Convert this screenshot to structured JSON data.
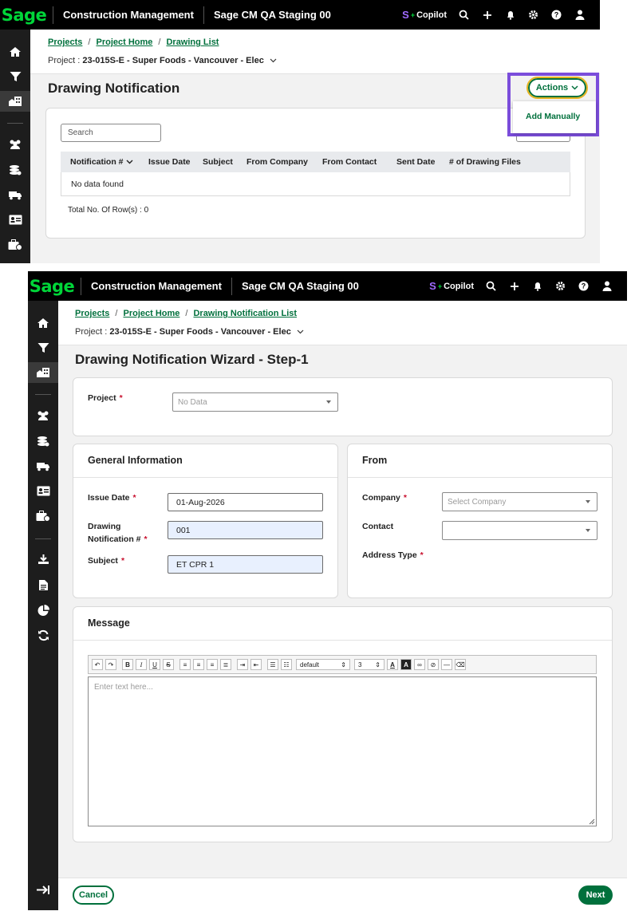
{
  "brand": {
    "logo": "Sage",
    "app_name": "Construction Management",
    "environment": "Sage CM QA Staging 00"
  },
  "topbar": {
    "copilot_label": "Copilot"
  },
  "screen1": {
    "breadcrumbs": [
      "Projects",
      "Project Home",
      "Drawing List"
    ],
    "project_prefix": "Project : ",
    "project_name": "23-015S-E - Super Foods - Vancouver - Elec",
    "title": "Drawing Notification",
    "actions_label": "Actions",
    "dropdown_item": "Add Manually",
    "search_placeholder": "Search",
    "columns": [
      "Notification #",
      "Issue Date",
      "Subject",
      "From Company",
      "From Contact",
      "Sent Date",
      "# of Drawing Files"
    ],
    "empty_text": "No data found",
    "total_rows": "Total No. Of Row(s) : 0"
  },
  "screen2": {
    "breadcrumbs": [
      "Projects",
      "Project Home",
      "Drawing Notification List"
    ],
    "project_prefix": "Project : ",
    "project_name": "23-015S-E - Super Foods - Vancouver - Elec",
    "title": "Drawing Notification Wizard - Step-1",
    "project_label": "Project",
    "project_select": "No Data",
    "general_title": "General Information",
    "issue_date_label": "Issue Date",
    "issue_date_value": "01-Aug-2026",
    "drawing_label_1": "Drawing",
    "drawing_label_2": "Notification #",
    "drawing_value": "001",
    "subject_label": "Subject",
    "subject_value": "ET CPR 1",
    "from_title": "From",
    "company_label": "Company",
    "company_placeholder": "Select Company",
    "contact_label": "Contact",
    "address_type_label": "Address Type",
    "message_title": "Message",
    "editor_placeholder": "Enter text here...",
    "font_select": "default",
    "size_select": "3",
    "cancel_label": "Cancel",
    "next_label": "Next"
  },
  "colors": {
    "accent": "#00703c",
    "highlight": "#7b4ddb",
    "brand_green": "#00d639"
  }
}
